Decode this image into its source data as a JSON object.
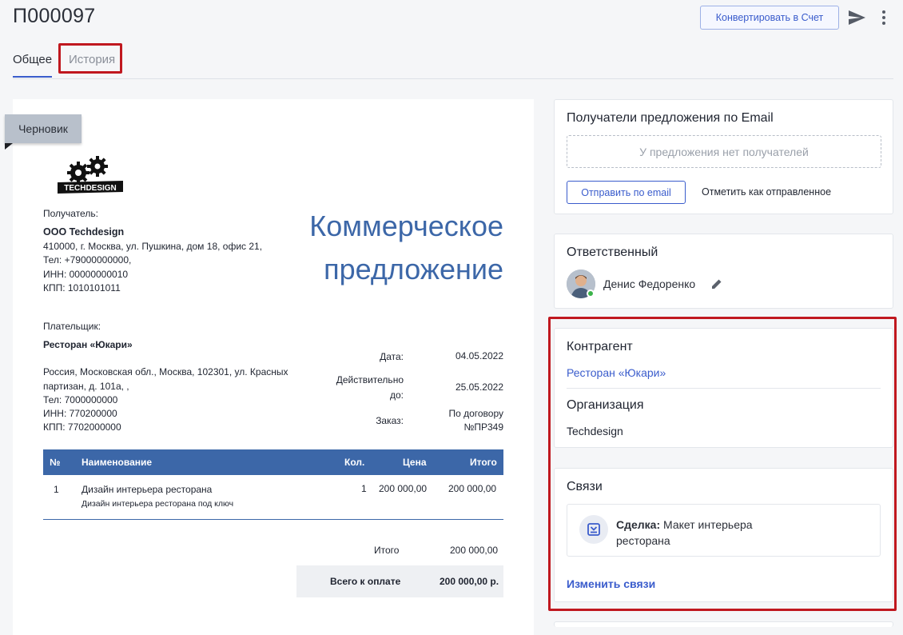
{
  "header": {
    "title": "П000097",
    "convert_label": "Конвертировать в Счет"
  },
  "tabs": [
    {
      "label": "Общее",
      "active": true
    },
    {
      "label": "История",
      "active": false
    }
  ],
  "document": {
    "status_badge": "Черновик",
    "logo_text": "TECHDESIGN",
    "heading_line1": "Коммерческое",
    "heading_line2": "предложение",
    "recipient": {
      "label": "Получатель:",
      "name": "ООО Techdesign",
      "address": "410000, г. Москва, ул. Пушкина, дом 18, офис 21,",
      "phone": "Тел: +79000000000,",
      "inn": "ИНН: 00000000010",
      "kpp": "КПП: 1010101011"
    },
    "payer": {
      "label": "Плательщик:",
      "name": "Ресторан «Юкари»",
      "address_line1": "Россия, Московская обл., Москва, 102301, ул. Красных",
      "address_line2": "партизан, д. 101а, ,",
      "phone": "Тел: 7000000000",
      "inn": "ИНН: 770200000",
      "kpp": "КПП: 7702000000"
    },
    "meta": {
      "date_label": "Дата:",
      "date_value": "04.05.2022",
      "valid_label_1": "Действительно",
      "valid_label_2": "до:",
      "valid_value": "25.05.2022",
      "order_label": "Заказ:",
      "order_value_1": "По договору",
      "order_value_2": "№ПР349"
    },
    "table": {
      "headers": {
        "num": "№",
        "name": "Наименование",
        "qty": "Кол.",
        "price": "Цена",
        "total": "Итого"
      },
      "rows": [
        {
          "num": "1",
          "name": "Дизайн интерьера ресторана",
          "desc": "Дизайн интерьера ресторана под ключ",
          "qty": "1",
          "price": "200 000,00",
          "total": "200 000,00"
        }
      ]
    },
    "totals": {
      "subtotal_label": "Итого",
      "subtotal_value": "200 000,00",
      "grand_label": "Всего к оплате",
      "grand_value": "200 000,00 р."
    }
  },
  "email_card": {
    "title": "Получатели предложения по Email",
    "empty_text": "У предложения нет получателей",
    "send_label": "Отправить по email",
    "mark_sent_label": "Отметить как отправленное"
  },
  "responsible_card": {
    "title": "Ответственный",
    "user_name": "Денис Федоренко"
  },
  "contractor_card": {
    "contractor_title": "Контрагент",
    "contractor_value": "Ресторан «Юкари»",
    "org_title": "Организация",
    "org_value": "Techdesign"
  },
  "links_card": {
    "title": "Связи",
    "deal_label": "Сделка:",
    "deal_value": "Макет интерьера ресторана",
    "edit_label": "Изменить связи"
  },
  "colors": {
    "accent": "#3a5ccc",
    "doc_blue": "#3c67a8",
    "highlight_red": "#c0181f",
    "online_green": "#3bb34a"
  }
}
